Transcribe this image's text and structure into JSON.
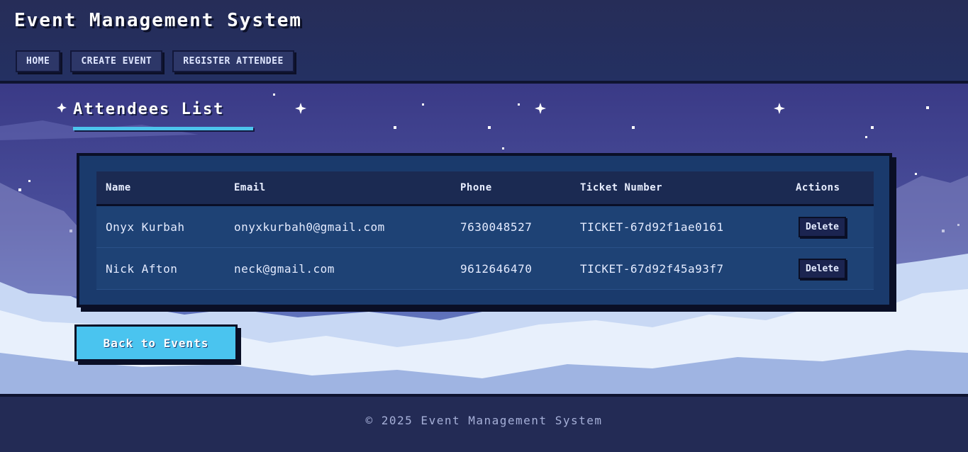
{
  "header": {
    "title": "Event Management System",
    "nav": [
      "HOME",
      "CREATE EVENT",
      "REGISTER ATTENDEE"
    ]
  },
  "page": {
    "title": "Attendees List"
  },
  "table": {
    "columns": [
      "Name",
      "Email",
      "Phone",
      "Ticket Number",
      "Actions"
    ],
    "rows": [
      {
        "name": "Onyx Kurbah",
        "email": "onyxkurbah0@gmail.com",
        "phone": "7630048527",
        "ticket": "TICKET-67d92f1ae0161",
        "action": "Delete"
      },
      {
        "name": "Nick Afton",
        "email": "neck@gmail.com",
        "phone": "9612646470",
        "ticket": "TICKET-67d92f45a93f7",
        "action": "Delete"
      }
    ]
  },
  "back_button": "Back to Events",
  "footer": {
    "text": "© 2025 Event Management System"
  },
  "colors": {
    "accent": "#4ac4ef",
    "header_bg": "#262d58",
    "panel_bg": "#1a3a6c"
  }
}
